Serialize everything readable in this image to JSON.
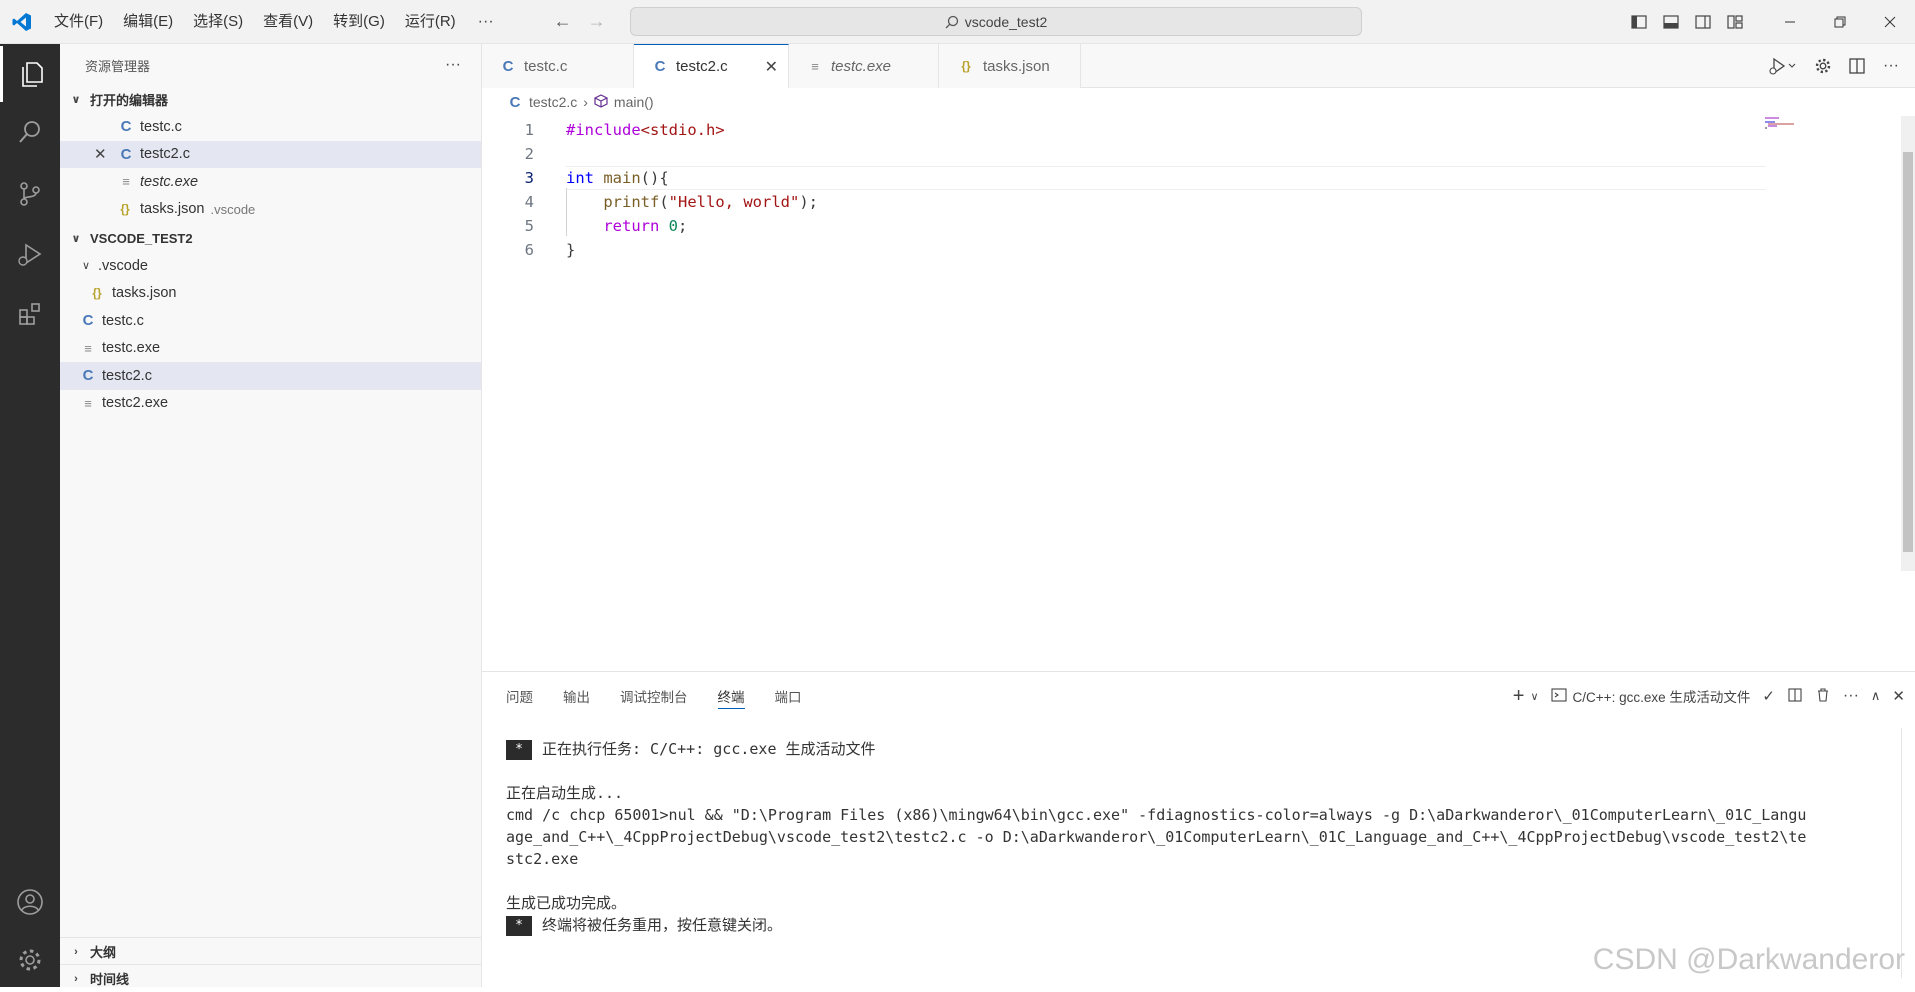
{
  "titlebar": {
    "menu": [
      "文件(F)",
      "编辑(E)",
      "选择(S)",
      "查看(V)",
      "转到(G)",
      "运行(R)"
    ],
    "more": "···",
    "search_text": "vscode_test2",
    "back_arrow": "←",
    "forward_arrow": "→"
  },
  "sidebar": {
    "title": "资源管理器",
    "more": "···",
    "open_editors": {
      "title": "打开的编辑器",
      "items": [
        {
          "name": "testc.c",
          "icon": "C",
          "suffix": ""
        },
        {
          "name": "testc2.c",
          "icon": "C",
          "suffix": ""
        },
        {
          "name": "testc.exe",
          "icon": "≡",
          "suffix": ""
        },
        {
          "name": "tasks.json",
          "icon": "{}",
          "suffix": ".vscode"
        }
      ]
    },
    "workspace": {
      "title": "VSCODE_TEST2",
      "folder": ".vscode",
      "items": [
        {
          "name": "tasks.json",
          "icon": "{}"
        },
        {
          "name": "testc.c",
          "icon": "C"
        },
        {
          "name": "testc.exe",
          "icon": "≡"
        },
        {
          "name": "testc2.c",
          "icon": "C"
        },
        {
          "name": "testc2.exe",
          "icon": "≡"
        }
      ]
    },
    "outline": "大纲",
    "timeline": "时间线"
  },
  "tabs": [
    {
      "label": "testc.c",
      "icon": "C"
    },
    {
      "label": "testc2.c",
      "icon": "C"
    },
    {
      "label": "testc.exe",
      "icon": "≡"
    },
    {
      "label": "tasks.json",
      "icon": "{}"
    }
  ],
  "breadcrumb": {
    "file": "testc2.c",
    "symbol": "main()",
    "sep": "›"
  },
  "editor": {
    "line_numbers": [
      "1",
      "2",
      "3",
      "4",
      "5",
      "6"
    ],
    "code": {
      "l1_pp": "#include",
      "l1_inc": "<stdio.h>",
      "l3_kw": "int",
      "l3_fn": "main",
      "l3_rest": "(){",
      "l4_fn": "printf",
      "l4_open": "(",
      "l4_str": "\"Hello, world\"",
      "l4_close": ");",
      "l5_kw": "return",
      "l5_num": "0",
      "l5_end": ";",
      "l6": "}"
    }
  },
  "panel": {
    "tabs": [
      "问题",
      "输出",
      "调试控制台",
      "终端",
      "端口"
    ],
    "active_tab": "终端",
    "terminal_name": "C/C++: gcc.exe 生成活动文件",
    "terminal_lines": {
      "badge": "*",
      "l1": "正在执行任务: C/C++: gcc.exe 生成活动文件",
      "l2": "正在启动生成...",
      "l3": "cmd /c chcp 65001>nul && \"D:\\Program Files (x86)\\mingw64\\bin\\gcc.exe\" -fdiagnostics-color=always -g D:\\aDarkwanderor\\_01ComputerLearn\\_01C_Langu",
      "l4": "age_and_C++\\_4CppProjectDebug\\vscode_test2\\testc2.c -o D:\\aDarkwanderor\\_01ComputerLearn\\_01C_Language_and_C++\\_4CppProjectDebug\\vscode_test2\\te",
      "l5": "stc2.exe",
      "l6": "生成已成功完成。",
      "l7": "终端将被任务重用，按任意键关闭。"
    }
  },
  "watermark": "CSDN @Darkwanderor",
  "colors": {
    "accent": "#005fb8",
    "activitybar": "#2c2c2c",
    "selection": "#e4e6f1"
  }
}
